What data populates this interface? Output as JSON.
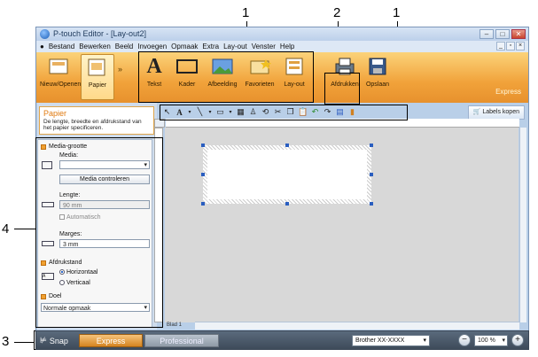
{
  "callouts": [
    "1",
    "2",
    "1",
    "4",
    "3"
  ],
  "window": {
    "title": "P-touch Editor - [Lay-out2]"
  },
  "menu": [
    "Bestand",
    "Bewerken",
    "Beeld",
    "Invoegen",
    "Opmaak",
    "Extra",
    "Lay-out",
    "Venster",
    "Help"
  ],
  "ribbon": {
    "left": [
      "Nieuw/Openen",
      "Papier"
    ],
    "insert": [
      "Tekst",
      "Kader",
      "Afbeelding",
      "Favorieten",
      "Lay-out"
    ],
    "print": [
      "Afdrukken",
      "Opslaan"
    ],
    "mode_ghost": "Express"
  },
  "toolbar": {
    "labels_button": "Labels kopen"
  },
  "side": {
    "title": "Papier",
    "desc": "De lengte, breedte en afdrukstand van het papier specificeren.",
    "media_size": "Media-grootte",
    "media_label": "Media:",
    "media_check": "Media controleren",
    "length_label": "Lengte:",
    "length_value": "90 mm",
    "auto_label": "Automatisch",
    "margins_label": "Marges:",
    "margins_value": "3 mm",
    "orientation": "Afdrukstand",
    "horizontal": "Horizontaal",
    "vertical": "Verticaal",
    "target": "Doel",
    "target_value": "Normale opmaak"
  },
  "sheet_tab": "Blad 1",
  "bottom": {
    "snap": "Snap",
    "express": "Express",
    "professional": "Professional",
    "printer": "Brother XX-XXXX",
    "zoom": "100 %"
  }
}
